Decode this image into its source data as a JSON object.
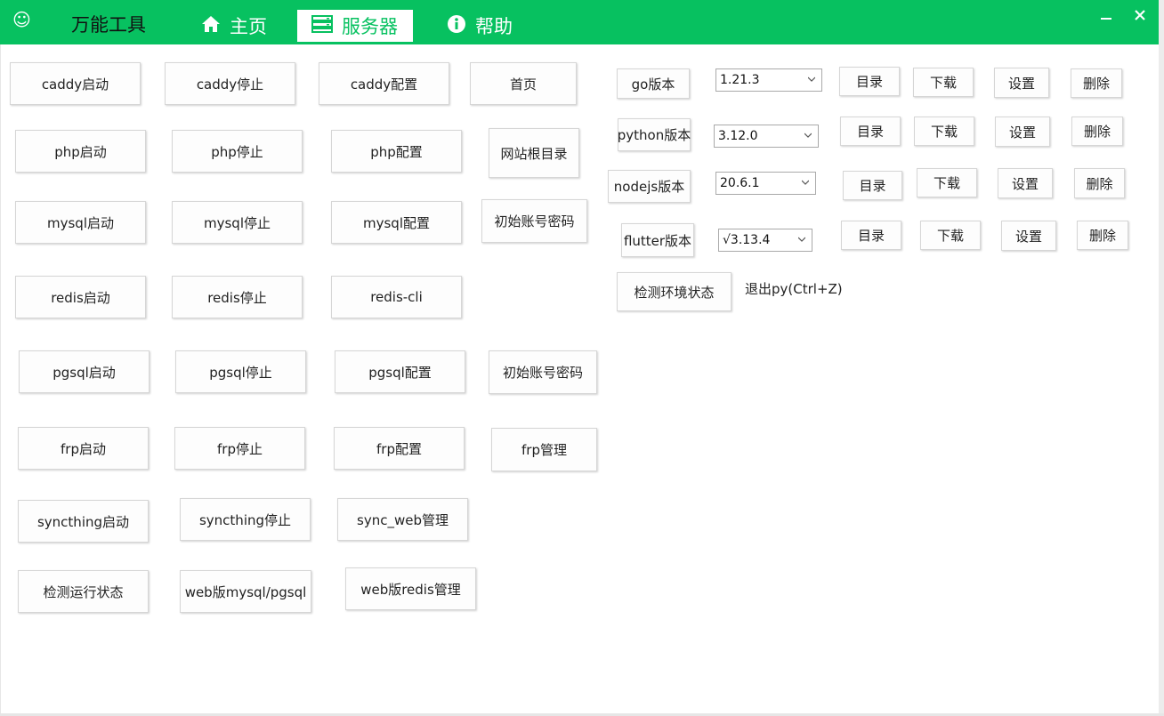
{
  "app": {
    "title": "万能工具",
    "smile_glyph": "☺"
  },
  "tabs": [
    {
      "label": "主页",
      "icon": "home-icon"
    },
    {
      "label": "服务器",
      "icon": "server-icon"
    },
    {
      "label": "帮助",
      "icon": "info-icon"
    }
  ],
  "window": {
    "minimize": "▬",
    "close": "✕"
  },
  "services": {
    "caddy": {
      "start": "caddy启动",
      "stop": "caddy停止",
      "config": "caddy配置",
      "extra": "首页"
    },
    "php": {
      "start": "php启动",
      "stop": "php停止",
      "config": "php配置",
      "extra": "网站根目录"
    },
    "mysql": {
      "start": "mysql启动",
      "stop": "mysql停止",
      "config": "mysql配置",
      "extra": "初始账号密码"
    },
    "redis": {
      "start": "redis启动",
      "stop": "redis停止",
      "config": "redis-cli"
    },
    "pgsql": {
      "start": "pgsql启动",
      "stop": "pgsql停止",
      "config": "pgsql配置",
      "extra": "初始账号密码"
    },
    "frp": {
      "start": "frp启动",
      "stop": "frp停止",
      "config": "frp配置",
      "extra": "frp管理"
    },
    "syncthing": {
      "start": "syncthing启动",
      "stop": "syncthing停止",
      "config": "sync_web管理"
    },
    "misc": {
      "check": "检测运行状态",
      "web_db": "web版mysql/pgsql",
      "web_redis": "web版redis管理"
    }
  },
  "versions": [
    {
      "label": "go版本",
      "value": "1.21.3",
      "dir": "目录",
      "download": "下载",
      "settings": "设置",
      "delete": "删除"
    },
    {
      "label": "python版本",
      "value": "3.12.0",
      "dir": "目录",
      "download": "下载",
      "settings": "设置",
      "delete": "删除"
    },
    {
      "label": "nodejs版本",
      "value": "20.6.1",
      "dir": "目录",
      "download": "下载",
      "settings": "设置",
      "delete": "删除"
    },
    {
      "label": "flutter版本",
      "value": "√3.13.4",
      "dir": "目录",
      "download": "下载",
      "settings": "设置",
      "delete": "删除"
    }
  ],
  "env": {
    "check": "检测环境状态",
    "exit_hint": "退出py(Ctrl+Z)"
  }
}
